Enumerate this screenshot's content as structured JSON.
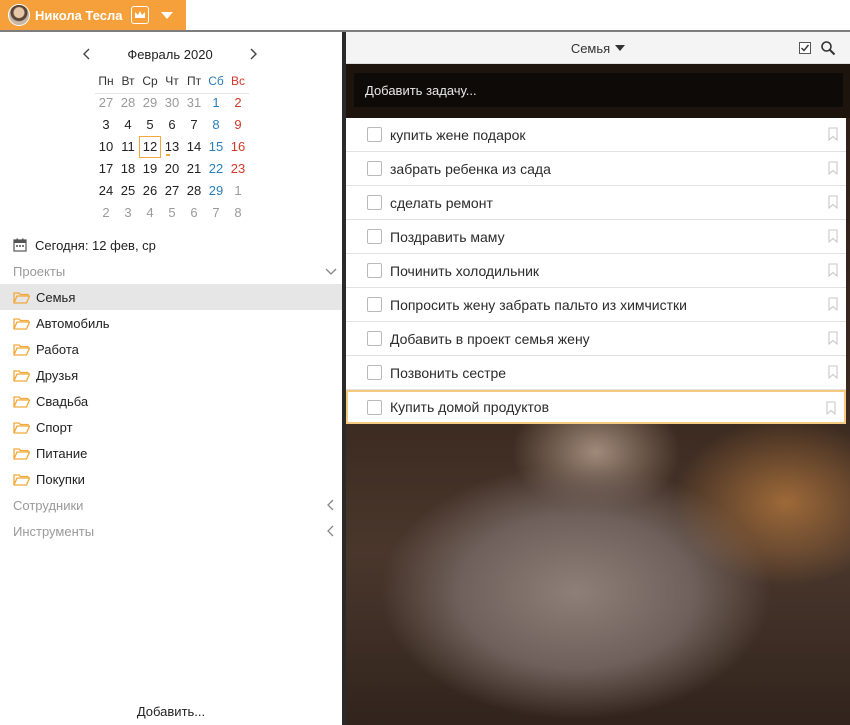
{
  "user": {
    "name": "Никола Тесла",
    "avatar_icon": "avatar-icon",
    "badge_icon": "crown-icon",
    "accent": "#f5a03a"
  },
  "calendar": {
    "month_label": "Февраль 2020",
    "weekdays": [
      "Пн",
      "Вт",
      "Ср",
      "Чт",
      "Пт",
      "Сб",
      "Вс"
    ],
    "weeks": [
      [
        "27",
        "28",
        "29",
        "30",
        "31",
        "1",
        "2"
      ],
      [
        "3",
        "4",
        "5",
        "6",
        "7",
        "8",
        "9"
      ],
      [
        "10",
        "11",
        "12",
        "13",
        "14",
        "15",
        "16"
      ],
      [
        "17",
        "18",
        "19",
        "20",
        "21",
        "22",
        "23"
      ],
      [
        "24",
        "25",
        "26",
        "27",
        "28",
        "29",
        "1"
      ],
      [
        "2",
        "3",
        "4",
        "5",
        "6",
        "7",
        "8"
      ]
    ],
    "selected_day": "12"
  },
  "today": {
    "label": "Сегодня: 12 фев, ср"
  },
  "sections": {
    "projects": "Проекты",
    "employees": "Сотрудники",
    "tools": "Инструменты"
  },
  "projects": [
    {
      "label": "Семья"
    },
    {
      "label": "Автомобиль"
    },
    {
      "label": "Работа"
    },
    {
      "label": "Друзья"
    },
    {
      "label": "Свадьба"
    },
    {
      "label": "Спорт"
    },
    {
      "label": "Питание"
    },
    {
      "label": "Покупки"
    }
  ],
  "add_label": "Добавить...",
  "list": {
    "title": "Семья",
    "add_task_placeholder": "Добавить задачу...",
    "tasks": [
      {
        "label": "купить жене подарок"
      },
      {
        "label": "забрать ребенка из сада"
      },
      {
        "label": "сделать ремонт"
      },
      {
        "label": "Поздравить маму"
      },
      {
        "label": "Починить холодильник"
      },
      {
        "label": "Попросить жену забрать пальто из химчистки"
      },
      {
        "label": "Добавить в проект семья жену"
      },
      {
        "label": "Позвонить сестре"
      },
      {
        "label": "Купить домой продуктов"
      }
    ]
  }
}
